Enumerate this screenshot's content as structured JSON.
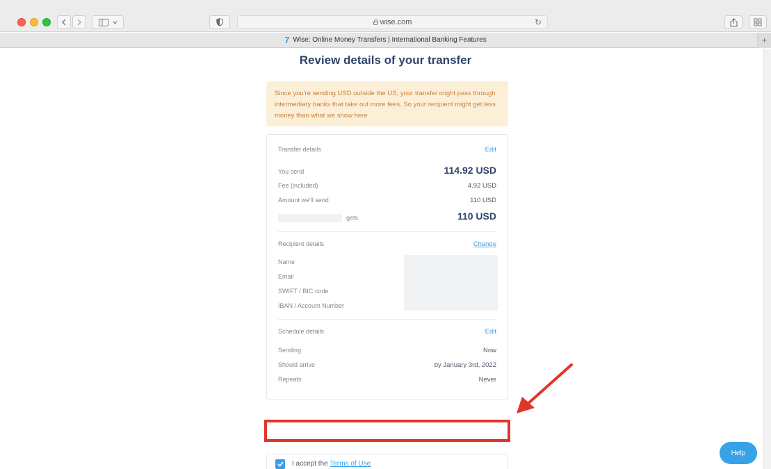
{
  "browser": {
    "url": "wise.com",
    "tab_title": "Wise: Online Money Transfers | International Banking Features",
    "tab_logo": "7"
  },
  "page": {
    "title": "Review details of your transfer",
    "warning": "Since you're sending USD outside the US, your transfer might pass through intermediary banks that take out more fees. So your recipient might get less money than what we show here."
  },
  "transfer": {
    "heading": "Transfer details",
    "edit": "Edit",
    "you_send_label": "You send",
    "you_send_value": "114.92 USD",
    "fee_label": "Fee (included)",
    "fee_value": "4.92 USD",
    "amount_label": "Amount we'll send",
    "amount_value": "110 USD",
    "gets_label": "gets",
    "gets_value": "110 USD"
  },
  "recipient": {
    "heading": "Recipient details",
    "change": "Change",
    "name_label": "Name",
    "email_label": "Email",
    "swift_label": "SWIFT / BIC code",
    "iban_label": "IBAN / Account Number"
  },
  "schedule": {
    "heading": "Schedule details",
    "edit": "Edit",
    "sending_label": "Sending",
    "sending_value": "Now",
    "arrive_label": "Should arrive",
    "arrive_value": "by January 3rd, 2022",
    "repeats_label": "Repeats",
    "repeats_value": "Never"
  },
  "terms": {
    "prefix": "I accept the",
    "link": "Terms of Use",
    "checked": true
  },
  "help": {
    "label": "Help"
  },
  "colors": {
    "brand": "#37a2e8",
    "title": "#2e4369",
    "warning_bg": "#fcefd7",
    "warning_text": "#c8833d",
    "annotation": "#e2352a"
  },
  "icons": [
    "back-icon",
    "forward-icon",
    "sidebar-icon",
    "shield-icon",
    "lock-icon",
    "reload-icon",
    "share-icon",
    "tabs-icon",
    "checkmark-icon",
    "arrow-annotation-icon"
  ]
}
